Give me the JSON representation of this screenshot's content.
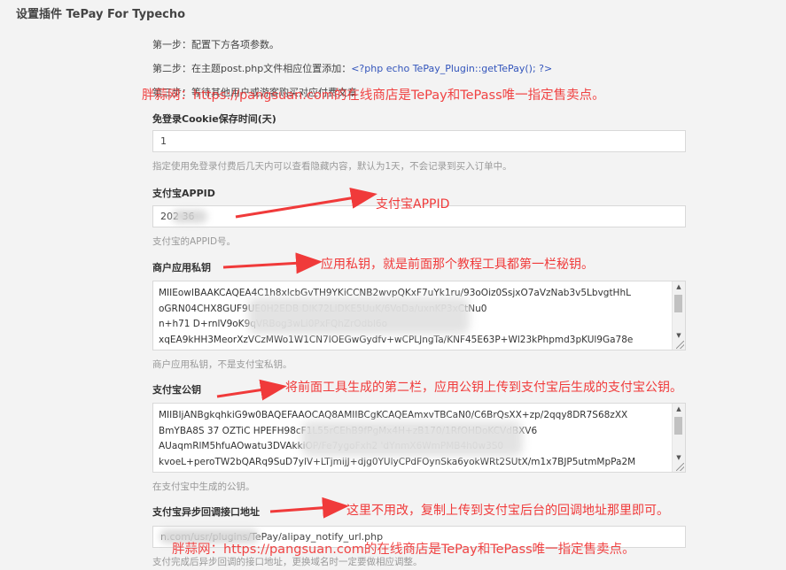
{
  "page": {
    "title": "设置插件 TePay For Typecho"
  },
  "steps": {
    "step1": "第一步：配置下方各项参数。",
    "step2_prefix": "第二步：在主题post.php文件相应位置添加：",
    "step2_code": "<?php echo TePay_Plugin::getTePay(); ?>",
    "step3": "第三步：等待其他用户或游客购买对应付费文章"
  },
  "fields": {
    "cookie_days": {
      "label": "免登录Cookie保存时间(天)",
      "value": "1",
      "description": "指定使用免登录付费后几天内可以查看隐藏内容，默认为1天，不会记录到买入订单中。"
    },
    "alipay_appid": {
      "label": "支付宝APPID",
      "value": "202       36",
      "description": "支付宝的APPID号。"
    },
    "private_key": {
      "label": "商户应用私钥",
      "lines": [
        "MIIEowIBAAKCAQEA4C1h8xlcbGvTH9YKiCCNB2wvpQKxF7uYk1ru/93oOiz0SsjxO7aVzNab3v5LbvgtHhL",
        "oGRN04CHX8GUF9UE0H2EDB                                    DlK72LiDKE5UuK/6VoDa/uxnKP3xCtNu0",
        "n+h71                                                              D+rnlV9oK9qVRBog3wLi0PxFQhZrOdbl6o",
        "xqEA9kHH3MeorXzVCzMWo1W1CN7lOEGwGydfv+wCPLJngTa/KNF45E63P+Wl23kPhpmd3pKUl9Ga78e"
      ],
      "description": "商户应用私钥，不是支付宝私钥。"
    },
    "public_key": {
      "label": "支付宝公钥",
      "lines": [
        "MIIBIjANBgkqhkiG9w0BAQEFAAOCAQ8AMIIBCgKCAQEAmxvTBCaN0/C6BrQsXX+zp/2qqy8DR7S68zXX",
        "BmYBA8S            37     OZTiC       HPEFH98cF1L55rCEhB9fPgMx4H+zB170/1RfOHDoKCVdBXV6",
        "AUaqmRlM5hfuAOwatu3DVAkkiOP/Fe7ygoFxh2                                'dYnmX6WmPMB4h0w3S0",
        "kvoeL+peroTW2bQARq9SuD7ylV+LTjmijJ+djg0YUlyCPdFOynSka6yokWRt2SUtX/m1x7BJP5utmMpPa2M"
      ],
      "description": "在支付宝中生成的公钥。"
    },
    "notify_url": {
      "label": "支付宝异步回调接口地址",
      "value": "                        n.com/usr/plugins/TePay/alipay_notify_url.php",
      "description": "支付完成后异步回调的接口地址，更换域名时一定要做相应调整。"
    }
  },
  "annotations": {
    "appid": "支付宝APPID",
    "private_key": "应用私钥，就是前面那个教程工具都第一栏秘钥。",
    "public_key": "将前面工具生成的第二栏，应用公钥上传到支付宝后生成的支付宝公钥。",
    "notify_url": "这里不用改，复制上传到支付宝后台的回调地址那里即可。"
  },
  "watermarks": {
    "top": "胖蒜网：https://pangsuan.com的在线商店是TePay和TePass唯一指定售卖点。",
    "bottom": "胖蒜网：https://pangsuan.com的在线商店是TePay和TePass唯一指定售卖点。"
  },
  "colors": {
    "annotation_red": "#f03a3a",
    "code_blue": "#3355bb",
    "background": "#f3f3f3"
  }
}
